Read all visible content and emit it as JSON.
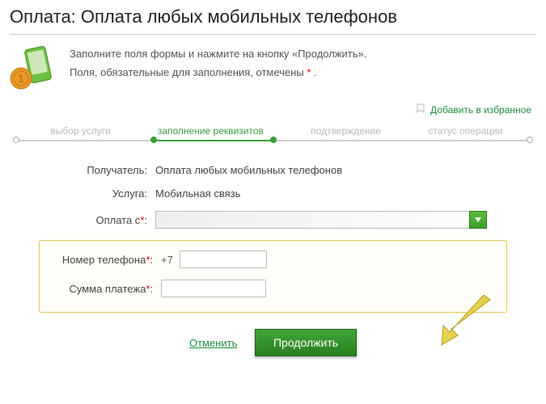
{
  "title": "Оплата: Оплата любых мобильных телефонов",
  "instructions": {
    "line1": "Заполните поля формы и нажмите на кнопку «Продолжить».",
    "line2_pre": "Поля, обязательные для заполнения, отмечены ",
    "req": "*",
    "line2_post": " ."
  },
  "favorite": {
    "label": "Добавить в избранное"
  },
  "steps": {
    "s1": "выбор услуги",
    "s2": "заполнение реквизитов",
    "s3": "подтверждение",
    "s4": "статус операции"
  },
  "form": {
    "recipient_label": "Получатель:",
    "recipient_value": "Оплата любых мобильных телефонов",
    "service_label": "Услуга:",
    "service_value": "Мобильная связь",
    "payfrom_label": "Оплата с",
    "req": "*",
    "colon": ":",
    "phone_label": "Номер телефона",
    "phone_prefix": "+7",
    "amount_label": "Сумма платежа"
  },
  "actions": {
    "cancel": "Отменить",
    "continue": "Продолжить"
  }
}
